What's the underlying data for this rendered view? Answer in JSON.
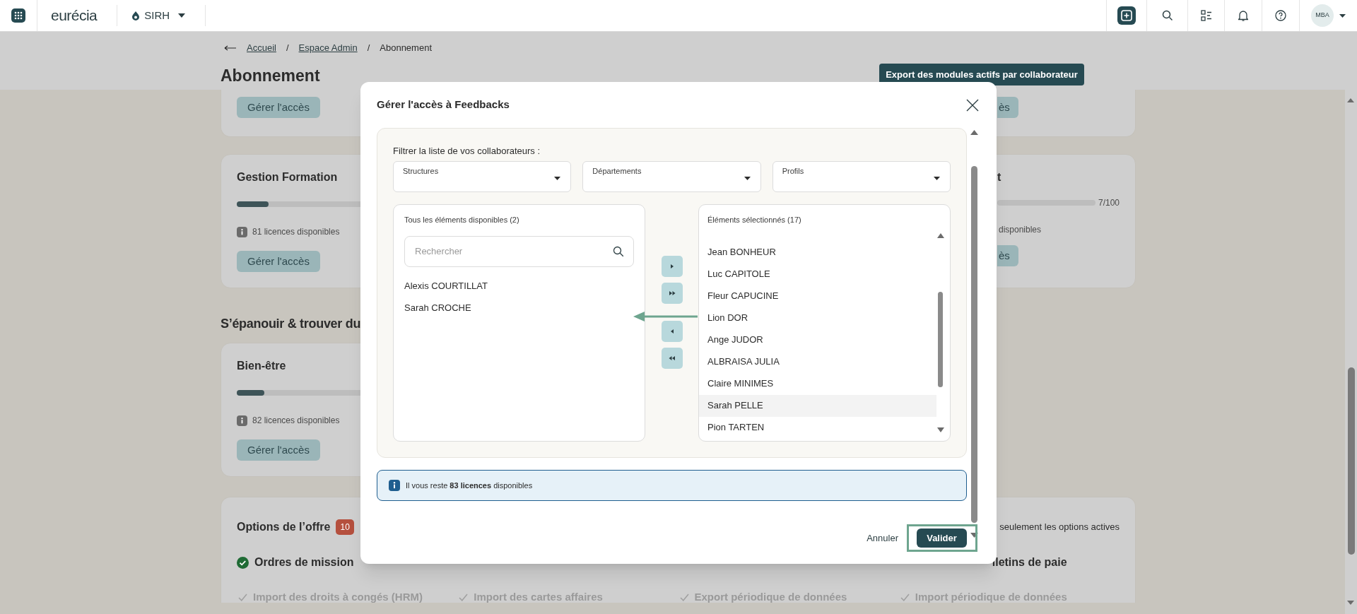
{
  "app_bar": {
    "logo": "eurécia",
    "module": "SIRH",
    "avatar": "MBA"
  },
  "breadcrumb": [
    {
      "label": "Accueil",
      "kind": "link"
    },
    {
      "label": "Espace Admin",
      "kind": "link"
    },
    {
      "label": "Abonnement",
      "kind": "current"
    }
  ],
  "breadcrumb_separators": [
    "/",
    "/"
  ],
  "page_title": "Abonnement",
  "export_button": "Export des modules actifs par collaborateur",
  "card_rows": [
    {
      "left": {
        "button": "Gérer l'accès"
      },
      "right": {
        "button": "ès"
      }
    },
    {
      "left": {
        "title": "Gestion Formation",
        "level": 0.08,
        "info": "81 licences disponibles",
        "button": "Gérer l'accès"
      },
      "right": {
        "title": "t",
        "reading": "7/100",
        "info": "disponibles",
        "button": "ès"
      }
    }
  ],
  "section_heading": "S’épanouir & trouver du",
  "section_cards": [
    {
      "title": "Bien-être",
      "level": 0.07,
      "info": "82 licences disponibles",
      "button": "Gérer l'accès"
    }
  ],
  "options": {
    "title": "Options de l’offre",
    "count": "10",
    "toggle_label": "seulement les options actives",
    "featured": [
      {
        "label": "Ordres de mission",
        "active": true
      },
      {
        "label": "lletins de paie",
        "active": true
      }
    ],
    "items": [
      {
        "label": "Import des droits à congés (HRM)",
        "active": false
      },
      {
        "label": "Import des cartes affaires",
        "active": false
      },
      {
        "label": "Export périodique de données",
        "active": false
      },
      {
        "label": "Import périodique de données",
        "active": false
      }
    ]
  },
  "modal": {
    "title": "Gérer l'accès à Feedbacks",
    "filter_label": "Filtrer la liste de vos collaborateurs :",
    "filters": [
      {
        "label": "Structures"
      },
      {
        "label": "Départements"
      },
      {
        "label": "Profils"
      }
    ],
    "available": {
      "title": "Tous les éléments disponibles (2)",
      "search_placeholder": "Rechercher",
      "items": [
        {
          "label": "Alexis COURTILLAT",
          "selected": false
        },
        {
          "label": "Sarah CROCHE",
          "selected": false
        }
      ]
    },
    "chosen": {
      "title": "Éléments sélectionnés (17)",
      "items": [
        {
          "label": "Jean BONHEUR",
          "selected": false
        },
        {
          "label": "Luc CAPITOLE",
          "selected": false
        },
        {
          "label": "Fleur CAPUCINE",
          "selected": false
        },
        {
          "label": "Lion DOR",
          "selected": false
        },
        {
          "label": "Ange JUDOR",
          "selected": false
        },
        {
          "label": "ALBRAISA JULIA",
          "selected": false
        },
        {
          "label": "Claire MINIMES",
          "selected": false
        },
        {
          "label": "Sarah PELLE",
          "selected": true
        },
        {
          "label": "Pion TARTEN",
          "selected": false
        }
      ]
    },
    "info": "Il vous reste **83 licences** disponibles",
    "cancel": "Annuler",
    "confirm": "Valider"
  }
}
